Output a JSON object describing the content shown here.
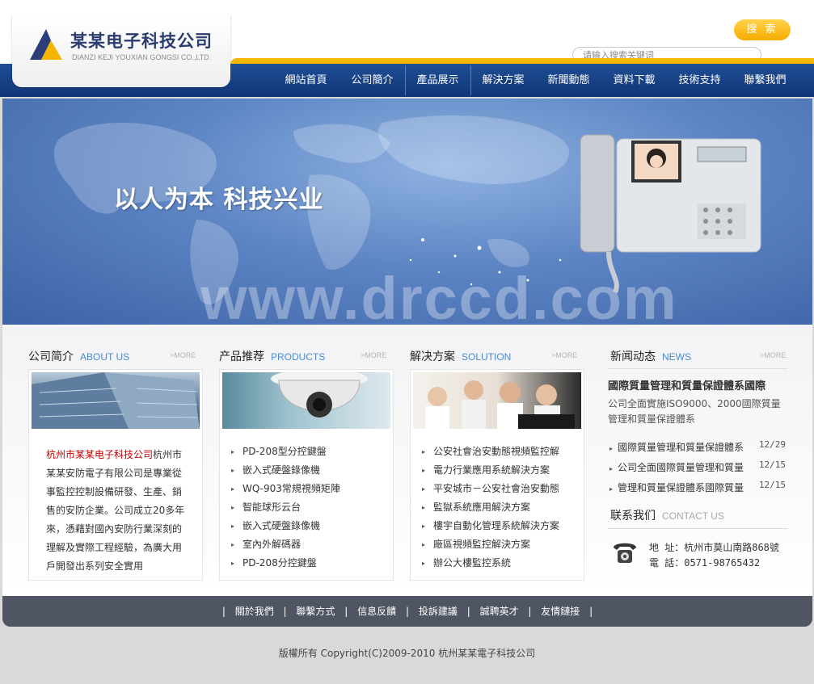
{
  "header": {
    "logo_cn": "某某电子科技公司",
    "logo_en": "DIANZI KEJI YOUXIAN GONGSI CO.,LTD.",
    "search_button": "搜 索",
    "search_value": "请输入搜索关键词"
  },
  "nav": [
    "網站首頁",
    "公司簡介",
    "產品展示",
    "解決方案",
    "新聞動態",
    "資料下載",
    "技術支持",
    "聯繫我們"
  ],
  "banner": {
    "slogan": "以人为本 科技兴业",
    "watermark": "www.drccd.com"
  },
  "about": {
    "title": "公司简介",
    "title_en": "ABOUT US",
    "more": ">MORE",
    "company_name": "杭州市某某电子科技公司",
    "text": "杭州市某某安防電子有限公司是專業從事監控控制設備研發、生產、銷售的安防企業。公司成立20多年來，憑藉對國內安防行業深刻的理解及實際工程經驗，為廣大用戶開發出系列安全實用"
  },
  "products": {
    "title": "产品推荐",
    "title_en": "PRODUCTS",
    "more": ">MORE",
    "items": [
      "PD-208型分控鍵盤",
      "嵌入式硬盤錄像機",
      "WQ-903常規視頻矩陣",
      "智能球形云台",
      "嵌入式硬盤錄像機",
      "室內外解碼器",
      "PD-208分控鍵盤"
    ]
  },
  "solutions": {
    "title": "解决方案",
    "title_en": "SOLUTION",
    "more": ">MORE",
    "items": [
      "公安社會治安動態視頻監控解",
      "電力行業應用系統解決方案",
      "平安城市－公安社會治安動態",
      "監獄系統應用解決方案",
      "樓宇自動化管理系統解決方案",
      "廠區視頻監控解決方案",
      "辦公大樓監控系統"
    ]
  },
  "news": {
    "title": "新闻动态",
    "title_en": "NEWS",
    "more": ">MORE",
    "headline": "國際質量管理和質量保證體系國際",
    "desc": "公司全面實施ISO9000、2000國際質量管理和質量保證體系",
    "items": [
      {
        "title": "國際質量管理和質量保證體系",
        "date": "12/29"
      },
      {
        "title": "公司全面國際質量管理和質量",
        "date": "12/15"
      },
      {
        "title": "管理和質量保證體系國際質量",
        "date": "12/15"
      }
    ]
  },
  "contact": {
    "title": "联系我们",
    "title_en": "CONTACT US",
    "address": "地  址：杭州市莫山南路868號",
    "phone": "電  話：0571-98765432"
  },
  "footer": {
    "links": [
      "關於我們",
      "聯繫方式",
      "信息反饋",
      "投訴建議",
      "誠聘英才",
      "友情鏈接"
    ],
    "copyright": "版權所有 Copyright(C)2009-2010 杭州某某電子科技公司"
  },
  "colors": {
    "nav_blue": "#103578",
    "accent_orange": "#f7b600",
    "accent_blue": "#4a8bd4",
    "footer_gray": "#4f5562"
  }
}
